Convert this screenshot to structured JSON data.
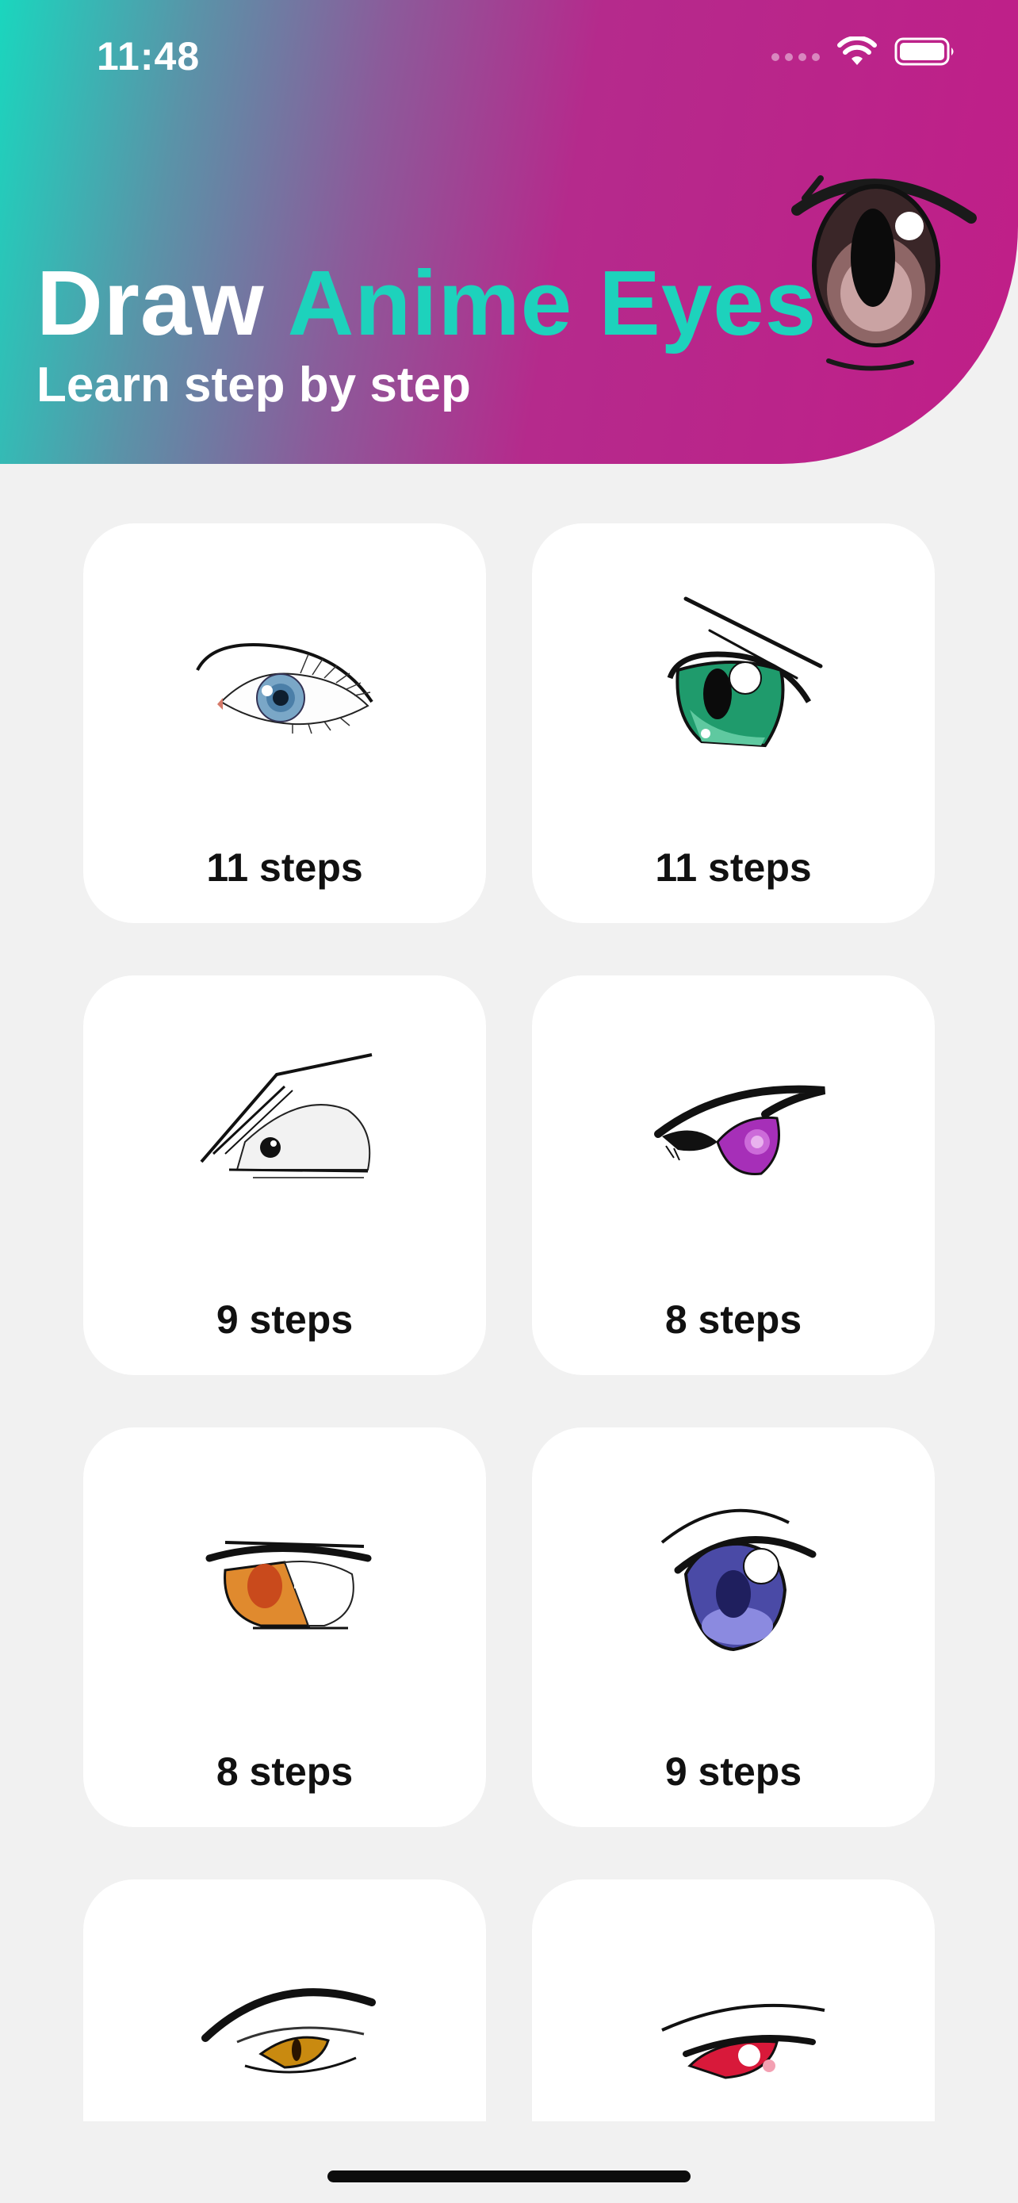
{
  "status_bar": {
    "time": "11:48",
    "icons": [
      "signal-icon",
      "wifi-icon",
      "battery-icon"
    ]
  },
  "header": {
    "title_part1": "Draw",
    "title_part2": "Anime Eyes",
    "subtitle": "Learn step by step",
    "accent_color": "#1dd2bc",
    "gradient_colors": [
      "#1ad6be",
      "#c01e88"
    ]
  },
  "cards": [
    {
      "steps": "11 steps",
      "illustration": "realistic-blue-eye"
    },
    {
      "steps": "11 steps",
      "illustration": "green-anime-eye"
    },
    {
      "steps": "9 steps",
      "illustration": "angry-eye"
    },
    {
      "steps": "8 steps",
      "illustration": "purple-eye"
    },
    {
      "steps": "8 steps",
      "illustration": "orange-eye"
    },
    {
      "steps": "9 steps",
      "illustration": "blue-anime-eye"
    },
    {
      "steps": "",
      "illustration": "golden-eye"
    },
    {
      "steps": "",
      "illustration": "red-eye"
    }
  ]
}
